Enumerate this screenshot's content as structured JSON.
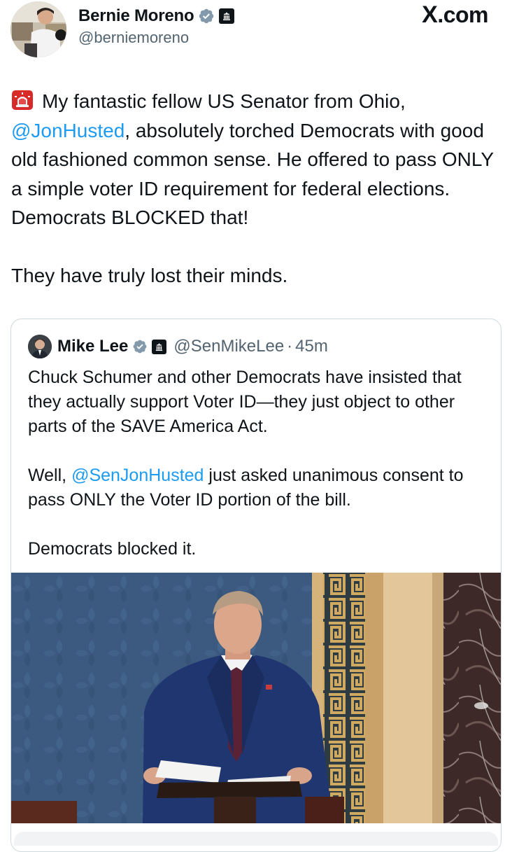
{
  "author": {
    "name": "Bernie Moreno",
    "handle": "@berniemoreno"
  },
  "brand": {
    "x": "X",
    "suffix": ".com"
  },
  "icons": {
    "verified": "verified-badge-icon",
    "government": "government-capitol-icon",
    "siren": "police-siren-emoji"
  },
  "tweet": {
    "line1_pre": "My fantastic fellow US Senator from Ohio,",
    "mention": "@JonHusted",
    "line2_post": ", absolutely torched Democrats with good old fashioned common sense. He offered to pass ONLY a simple voter ID requirement for federal elections. Democrats BLOCKED that!",
    "closing": "They have truly lost their minds."
  },
  "quote": {
    "name": "Mike Lee",
    "handle": "@SenMikeLee",
    "separator": "·",
    "time": "45m",
    "para1": "Chuck Schumer and other Democrats have insisted that they actually support Voter ID—they just object to other parts of the SAVE America Act.",
    "para2_pre": "Well, ",
    "para2_mention": "@SenJonHusted",
    "para2_post": " just asked unanimous consent to pass ONLY the Voter ID portion of the bill.",
    "para3": "Democrats blocked it."
  },
  "colors": {
    "link": "#1d9bf0",
    "text": "#0f1419",
    "secondary": "#536471",
    "border": "#cfd9de",
    "verified": "#829aab"
  }
}
